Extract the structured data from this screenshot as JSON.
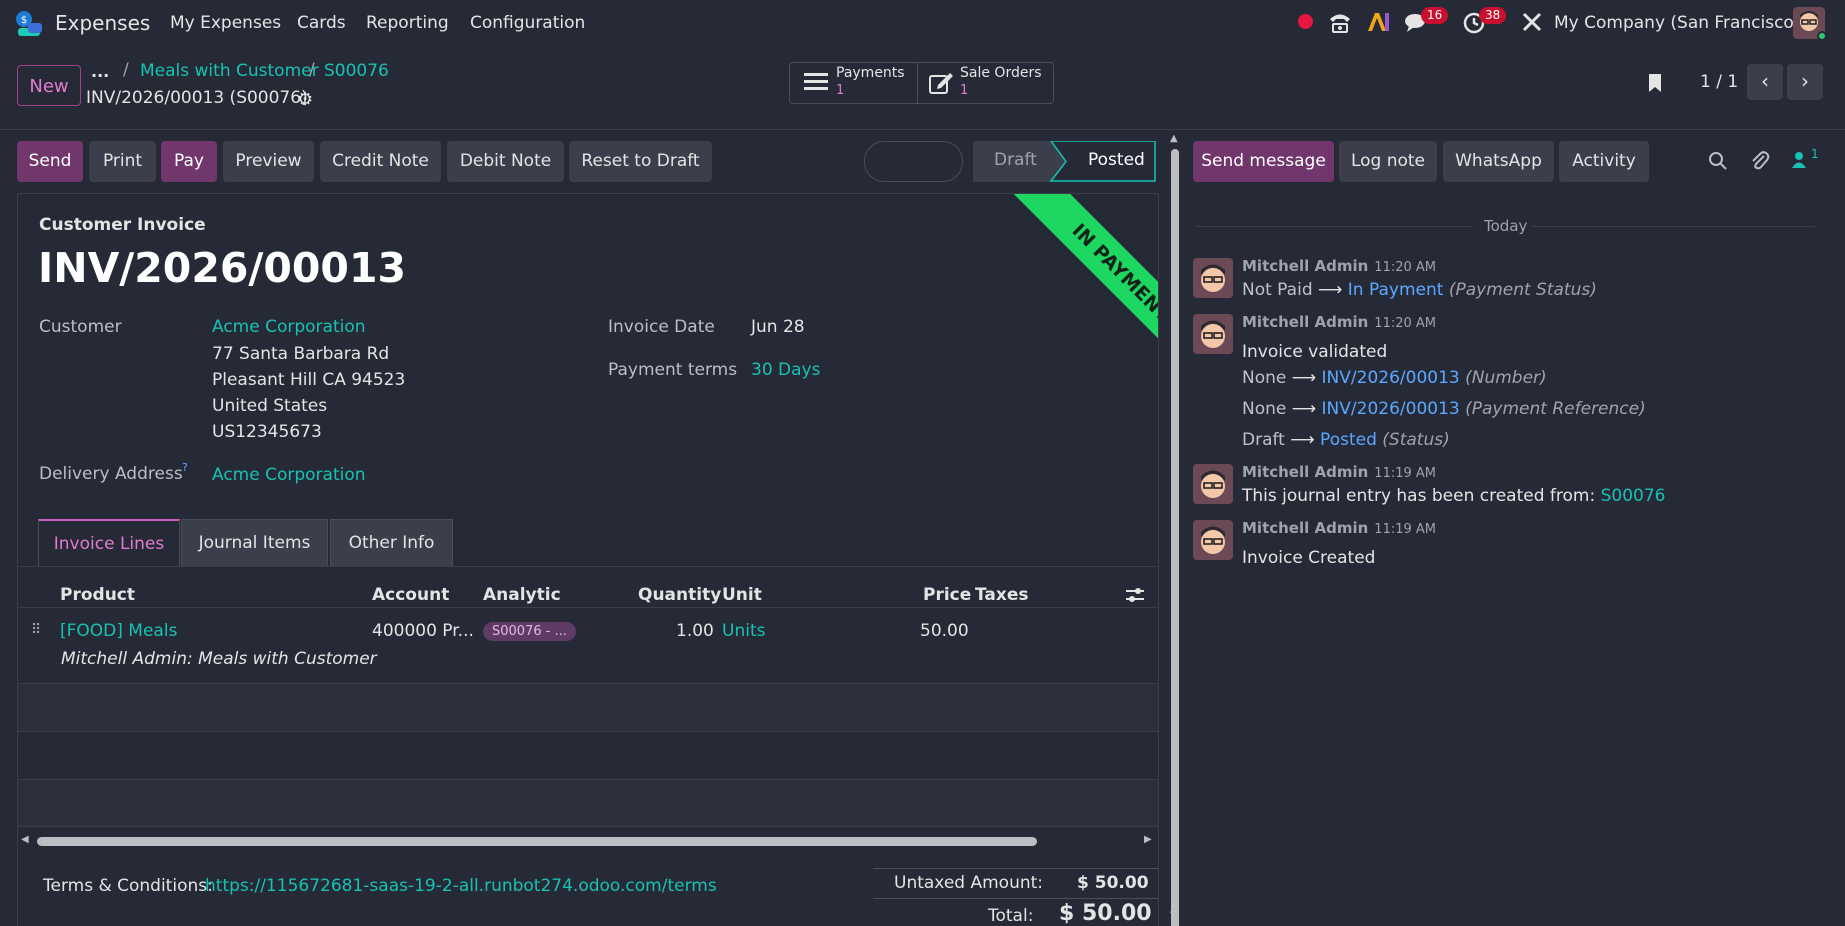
{
  "app": {
    "name": "Expenses",
    "menus": [
      "My Expenses",
      "Cards",
      "Reporting",
      "Configuration"
    ],
    "messages_count": "16",
    "activities_count": "38",
    "company": "My Company (San Francisco)"
  },
  "control": {
    "new_label": "New",
    "more_label": "...",
    "breadcrumb": [
      "Meals with Customer",
      "S00076"
    ],
    "record_title": "INV/2026/00013 (S00076)",
    "smart_buttons": [
      {
        "label": "Payments",
        "count": "1"
      },
      {
        "label": "Sale Orders",
        "count": "1"
      }
    ],
    "pager": "1 / 1"
  },
  "actions": [
    "Send",
    "Print",
    "Pay",
    "Preview",
    "Credit Note",
    "Debit Note",
    "Reset to Draft"
  ],
  "status": {
    "draft": "Draft",
    "posted": "Posted"
  },
  "ribbon": "IN PAYMENT",
  "invoice": {
    "type_label": "Customer Invoice",
    "number": "INV/2026/00013",
    "customer_label": "Customer",
    "customer_name": "Acme Corporation",
    "address": [
      "77 Santa Barbara Rd",
      "Pleasant Hill CA 94523",
      "United States",
      "US12345673"
    ],
    "delivery_label": "Delivery Address",
    "delivery_help": "?",
    "delivery_name": "Acme Corporation",
    "invoice_date_label": "Invoice Date",
    "invoice_date": "Jun 28",
    "payment_terms_label": "Payment terms",
    "payment_terms": "30 Days"
  },
  "tabs": [
    "Invoice Lines",
    "Journal Items",
    "Other Info"
  ],
  "lines": {
    "headers": {
      "product": "Product",
      "account": "Account",
      "analytic": "Analytic",
      "quantity": "Quantity",
      "unit": "Unit",
      "price": "Price",
      "taxes": "Taxes"
    },
    "rows": [
      {
        "product": "[FOOD] Meals",
        "description": "Mitchell Admin: Meals with Customer",
        "account": "400000 Pr...",
        "analytic": "S00076 - ...",
        "quantity": "1.00",
        "unit": "Units",
        "price": "50.00"
      }
    ]
  },
  "footer": {
    "terms_label": "Terms & Conditions:",
    "terms_url": "https://115672681-saas-19-2-all.runbot274.odoo.com/terms",
    "untaxed_label": "Untaxed Amount:",
    "untaxed_value": "$ 50.00",
    "total_label": "Total:",
    "total_value": "$ 50.00"
  },
  "chatter": {
    "buttons": [
      "Send message",
      "Log note",
      "WhatsApp",
      "Activity"
    ],
    "followers_count": "1",
    "day_label": "Today",
    "messages": [
      {
        "author": "Mitchell Admin",
        "time": "11:20 AM"
      },
      {
        "author": "Mitchell Admin",
        "time": "11:20 AM"
      },
      {
        "author": "Mitchell Admin",
        "time": "11:19 AM"
      },
      {
        "author": "Mitchell Admin",
        "time": "11:19 AM"
      }
    ],
    "m1": {
      "old": "Not Paid",
      "new": "In Payment",
      "field": "(Payment Status)"
    },
    "m2": {
      "title": "Invoice validated",
      "changes": [
        {
          "old": "None",
          "new": "INV/2026/00013",
          "field": "(Number)"
        },
        {
          "old": "None",
          "new": "INV/2026/00013",
          "field": "(Payment Reference)"
        },
        {
          "old": "Draft",
          "new": "Posted",
          "field": "(Status)"
        }
      ]
    },
    "m3": {
      "text": "This journal entry has been created from:",
      "link": "S00076"
    },
    "m4": {
      "text": "Invoice Created"
    }
  },
  "colors": {
    "primary": "#71366B",
    "accent": "#17C2B3",
    "ribbon": "#1ED760",
    "badge": "#C8102E",
    "bg": "#262A36"
  }
}
